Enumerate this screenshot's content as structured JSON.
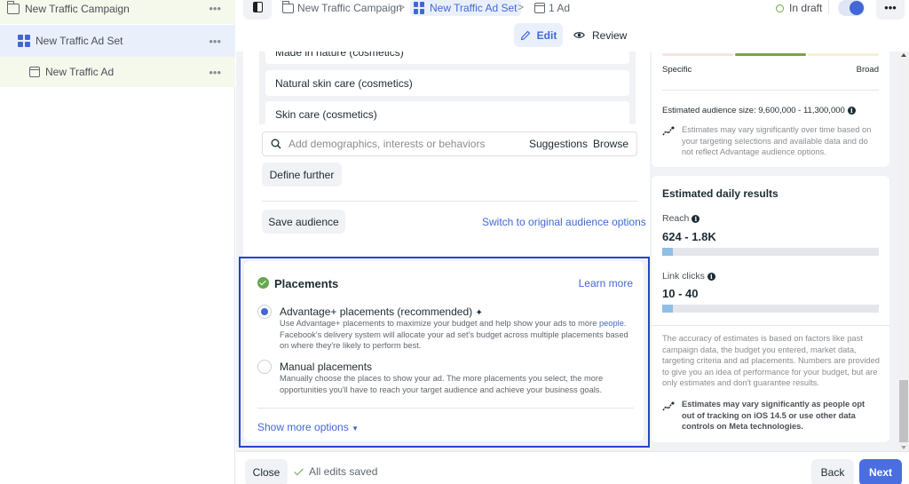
{
  "sidebar": {
    "items": [
      {
        "label": "New Traffic Campaign",
        "icon": "folder-icon",
        "more": "•••"
      },
      {
        "label": "New Traffic Ad Set",
        "icon": "ad-set-grid-icon",
        "more": "•••"
      },
      {
        "label": "New Traffic Ad",
        "icon": "ad-icon",
        "more": "•••"
      }
    ]
  },
  "topbar": {
    "breadcrumb": [
      {
        "label": "New Traffic Campaign"
      },
      {
        "label": "New Traffic Ad Set"
      },
      {
        "label": "1 Ad"
      }
    ],
    "separator": ">",
    "status": "In draft",
    "more": "•••",
    "toggle_on": true
  },
  "mode_tabs": {
    "edit": "Edit",
    "review": "Review"
  },
  "audience": {
    "interests": [
      "Made in nature (cosmetics)",
      "Natural skin care (cosmetics)",
      "Skin care (cosmetics)"
    ],
    "search_placeholder": "Add demographics, interests or behaviors",
    "suggestions": "Suggestions",
    "browse": "Browse",
    "define_further": "Define further",
    "save_audience": "Save audience",
    "switch_link": "Switch to original audience options"
  },
  "placements": {
    "title": "Placements",
    "learn_more": "Learn more",
    "options": [
      {
        "title": "Advantage+ placements (recommended)",
        "desc_before_link": "Use Advantage+ placements to maximize your budget and help show your ads to more ",
        "desc_link": "people",
        "desc_after_link": ". Facebook's delivery system will allocate your ad set's budget across multiple placements based on where they're likely to perform best.",
        "selected": true
      },
      {
        "title": "Manual placements",
        "desc": "Manually choose the places to show your ad. The more placements you select, the more opportunities you'll have to reach your target audience and achieve your business goals.",
        "selected": false
      }
    ],
    "show_more": "Show more options"
  },
  "audience_meter": {
    "left_label": "Specific",
    "right_label": "Broad",
    "colors": {
      "specific": "#f4e4e0",
      "middle": "#76a641",
      "broad": "#f6f1d5"
    },
    "size_label": "Estimated audience size: 9,600,000 - 11,300,000",
    "note": "Estimates may vary significantly over time based on your targeting selections and available data and do not reflect Advantage audience options."
  },
  "estimated_results": {
    "title": "Estimated daily results",
    "metrics": [
      {
        "label": "Reach",
        "value": "624 - 1.8K",
        "fill_fraction": 0.05
      },
      {
        "label": "Link clicks",
        "value": "10 - 40",
        "fill_fraction": 0.05
      }
    ],
    "accuracy_note": "The accuracy of estimates is based on factors like past campaign data, the budget you entered, market data, targeting criteria and ad placements. Numbers are provided to give you an idea of performance for your budget, but are only estimates and don't guarantee results.",
    "ios_note": "Estimates may vary significantly as people opt out of tracking on iOS 14.5 or use other data controls on Meta technologies."
  },
  "footer": {
    "close": "Close",
    "saved_status": "All edits saved",
    "back": "Back",
    "next": "Next"
  },
  "colors": {
    "accent": "#4267d6",
    "success": "#63a84e",
    "highlight_border": "#2645c9"
  }
}
